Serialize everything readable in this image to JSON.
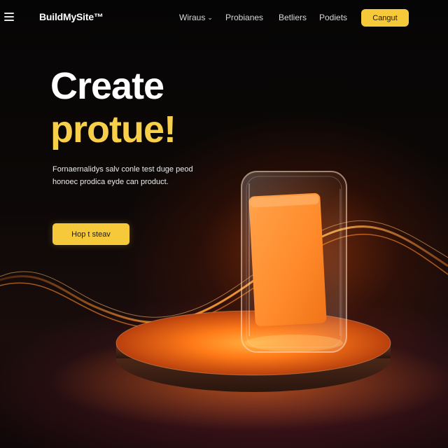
{
  "header": {
    "logo": "BuildMySite™",
    "nav": [
      {
        "label": "Wiraus",
        "has_dropdown": true
      },
      {
        "label": "Probianes",
        "has_dropdown": false
      },
      {
        "label": "Betliers",
        "has_dropdown": false
      },
      {
        "label": "Podiets",
        "has_dropdown": false
      }
    ],
    "cta_label": "Cangut"
  },
  "hero": {
    "title_line1": "Create",
    "title_line2": "protue!",
    "subtitle_line1": "Fornaernalidys salv conle test duge peod",
    "subtitle_line2": "honoec prodica eyde can product.",
    "button_label": "Hop t steav"
  },
  "icons": {
    "menu": "hamburger-icon",
    "chevron": "chevron-down-icon"
  },
  "colors": {
    "accent_yellow": "#f6c93b",
    "title_yellow": "#f8cf4a",
    "product_orange": "#ff8a2a",
    "background": "#0a0706"
  }
}
